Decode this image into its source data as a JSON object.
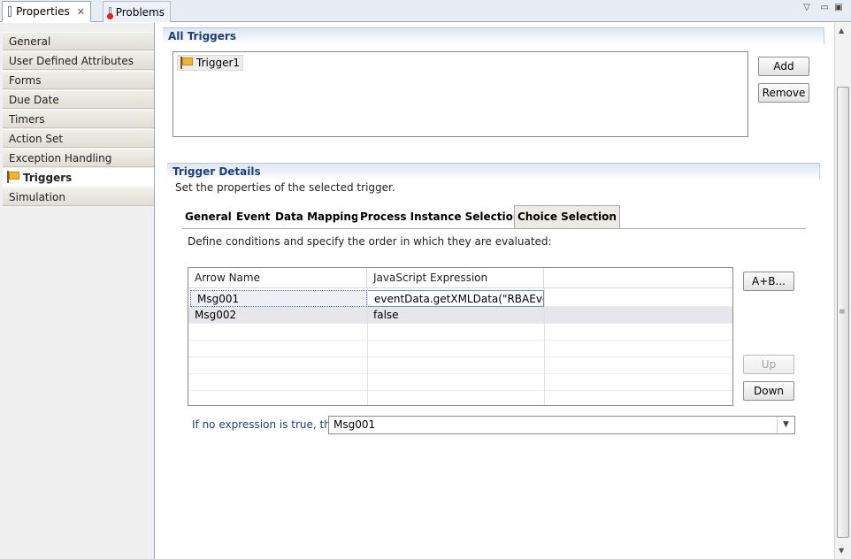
{
  "tabs": [
    {
      "label": "Properties",
      "active": true,
      "icon": "properties-icon"
    },
    {
      "label": "Problems",
      "active": false,
      "icon": "problems-icon"
    }
  ],
  "categories": [
    {
      "label": "General"
    },
    {
      "label": "User Defined Attributes"
    },
    {
      "label": "Forms"
    },
    {
      "label": "Due Date"
    },
    {
      "label": "Timers"
    },
    {
      "label": "Action Set"
    },
    {
      "label": "Exception Handling"
    },
    {
      "label": "Triggers",
      "selected": true,
      "icon": "flag-icon"
    },
    {
      "label": "Simulation"
    }
  ],
  "all_triggers": {
    "title": "All Triggers",
    "items": [
      "Trigger1"
    ],
    "add_label": "Add",
    "remove_label": "Remove"
  },
  "trigger_details": {
    "title": "Trigger Details",
    "description": "Set the properties of the selected trigger.",
    "tabs": [
      "General",
      "Event",
      "Data Mapping",
      "Process Instance Selection",
      "Choice Selection"
    ],
    "active_tab": "Choice Selection",
    "instruction": "Define conditions and specify the order in which they are evaluated:",
    "columns": [
      "Arrow Name",
      "JavaScript Expression"
    ],
    "rows": [
      {
        "arrow": "Msg001",
        "expression": "eventData.getXMLData(\"RBAEve..."
      },
      {
        "arrow": "Msg002",
        "expression": "false"
      }
    ],
    "expr_button_label": "A+B...",
    "up_label": "Up",
    "down_label": "Down",
    "fallback_label": "If no expression is true, then:",
    "fallback_value": "Msg001"
  },
  "colors": {
    "section_title": "#1c3f7a",
    "link_label": "#1c3f7a"
  }
}
